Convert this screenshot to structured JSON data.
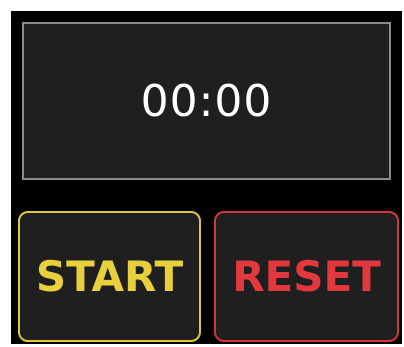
{
  "timer": {
    "display": "00:00"
  },
  "controls": {
    "start_label": "START",
    "reset_label": "RESET"
  },
  "colors": {
    "background": "#000000",
    "display_bg": "#1f1f1f",
    "display_border": "#8a8a8a",
    "start_accent": "#e8cf3c",
    "reset_accent": "#e2383e"
  }
}
